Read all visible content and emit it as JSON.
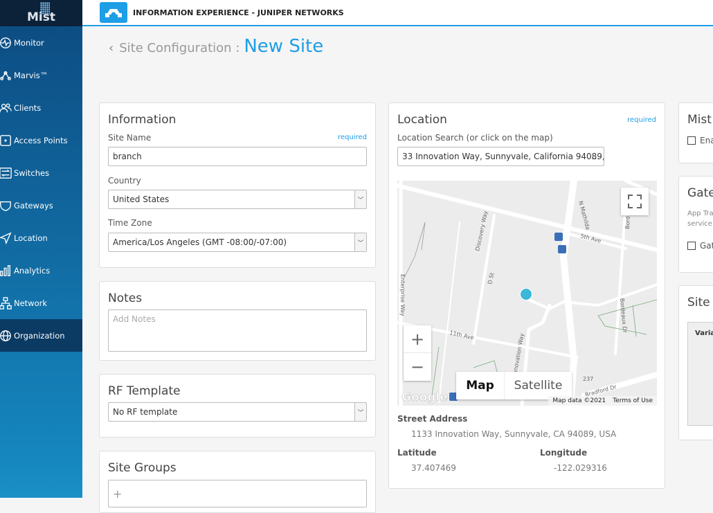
{
  "sidebar": {
    "logo": "Mist",
    "items": [
      {
        "label": "Monitor",
        "icon": "pulse-icon"
      },
      {
        "label": "Marvis™",
        "icon": "marvis-icon"
      },
      {
        "label": "Clients",
        "icon": "users-icon"
      },
      {
        "label": "Access Points",
        "icon": "access-point-icon"
      },
      {
        "label": "Switches",
        "icon": "switch-icon"
      },
      {
        "label": "Gateways",
        "icon": "shield-icon"
      },
      {
        "label": "Location",
        "icon": "location-arrow-icon"
      },
      {
        "label": "Analytics",
        "icon": "bar-chart-icon"
      },
      {
        "label": "Network",
        "icon": "network-icon"
      },
      {
        "label": "Organization",
        "icon": "globe-icon",
        "active": true
      }
    ]
  },
  "header": {
    "org": "INFORMATION EXPERIENCE - JUNIPER NETWORKS"
  },
  "breadcrumb": {
    "parent": "Site Configuration :",
    "title": "New Site"
  },
  "information": {
    "title": "Information",
    "site_name_label": "Site Name",
    "required": "required",
    "site_name": "branch",
    "country_label": "Country",
    "country": "United States",
    "tz_label": "Time Zone",
    "tz": "America/Los Angeles (GMT -08:00/-07:00)"
  },
  "notes": {
    "title": "Notes",
    "placeholder": "Add Notes"
  },
  "rf": {
    "title": "RF Template",
    "value": "No RF template"
  },
  "groups": {
    "title": "Site Groups",
    "add": "+"
  },
  "location": {
    "title": "Location",
    "required": "required",
    "search_label": "Location Search (or click on the map)",
    "search": "33 Innovation Way, Sunnyvale, California 94089,",
    "more": "...",
    "street_label": "Street Address",
    "street": "1133 Innovation Way, Sunnyvale, CA 94089, USA",
    "lat_label": "Latitude",
    "lat": "37.407469",
    "lon_label": "Longitude",
    "lon": "-122.029316"
  },
  "map": {
    "map_btn": "Map",
    "satellite_btn": "Satellite",
    "zoom_in": "+",
    "zoom_out": "−",
    "attribution": "Map data ©2021",
    "terms": "Terms of Use",
    "google": "Google",
    "streets": [
      "N Mathilda",
      "5th Ave",
      "Discovery Way",
      "D St",
      "Enterprise Way",
      "11th Ave",
      "Innovation Way",
      "Bordeaux Dr",
      "Bradford Dr",
      "237",
      "Bord"
    ],
    "marker_color": "#3bb8d8"
  },
  "right": {
    "mist_title": "Mist T",
    "enable": "Ena",
    "gw_title": "Gatew",
    "gw_desc1": "App Tra",
    "gw_desc2": "service",
    "gw_check": "Gat",
    "vars_title": "Site V",
    "vars_header": "Varia"
  }
}
